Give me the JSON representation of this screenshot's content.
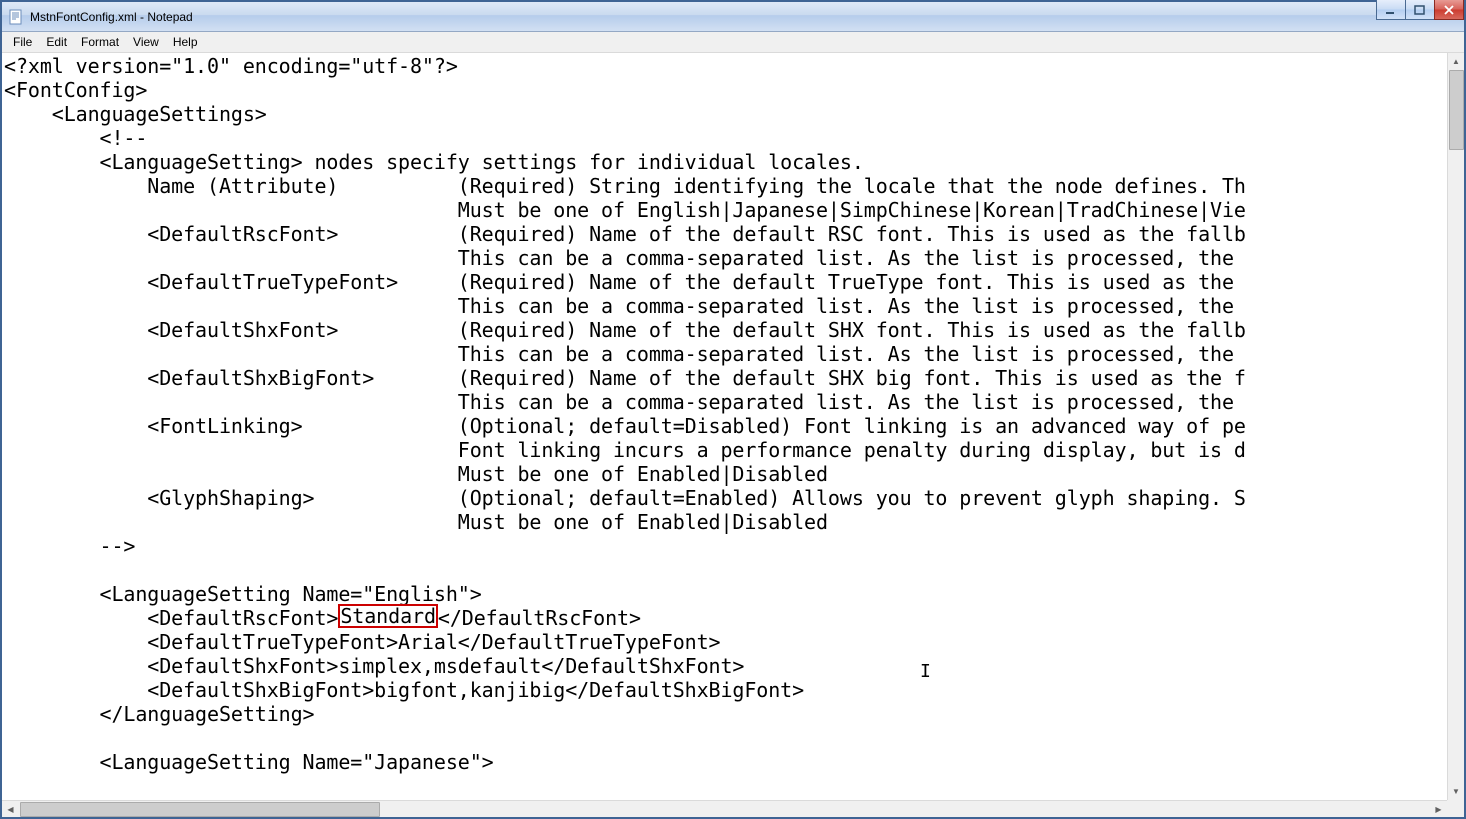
{
  "window": {
    "title": "MstnFontConfig.xml - Notepad"
  },
  "menu": {
    "file": "File",
    "edit": "Edit",
    "format": "Format",
    "view": "View",
    "help": "Help"
  },
  "content": {
    "l0": "<?xml version=\"1.0\" encoding=\"utf-8\"?>",
    "l1": "<FontConfig>",
    "l2": "    <LanguageSettings>",
    "l3": "        <!--",
    "l4": "        <LanguageSetting> nodes specify settings for individual locales.",
    "l5": "            Name (Attribute)          (Required) String identifying the locale that the node defines. Th",
    "l6": "                                      Must be one of English|Japanese|SimpChinese|Korean|TradChinese|Vie",
    "l7": "            <DefaultRscFont>          (Required) Name of the default RSC font. This is used as the fallb",
    "l8": "                                      This can be a comma-separated list. As the list is processed, the ",
    "l9": "            <DefaultTrueTypeFont>     (Required) Name of the default TrueType font. This is used as the ",
    "l10": "                                      This can be a comma-separated list. As the list is processed, the ",
    "l11": "            <DefaultShxFont>          (Required) Name of the default SHX font. This is used as the fallb",
    "l12": "                                      This can be a comma-separated list. As the list is processed, the ",
    "l13": "            <DefaultShxBigFont>       (Required) Name of the default SHX big font. This is used as the f",
    "l14": "                                      This can be a comma-separated list. As the list is processed, the ",
    "l15": "            <FontLinking>             (Optional; default=Disabled) Font linking is an advanced way of pe",
    "l16": "                                      Font linking incurs a performance penalty during display, but is d",
    "l17": "                                      Must be one of Enabled|Disabled",
    "l18": "            <GlyphShaping>            (Optional; default=Enabled) Allows you to prevent glyph shaping. S",
    "l19": "                                      Must be one of Enabled|Disabled",
    "l20": "        -->",
    "l21": "",
    "l22": "        <LanguageSetting Name=\"English\">",
    "l23a": "            <DefaultRscFont>",
    "l23hl": "Standard",
    "l23b": "</DefaultRscFont>",
    "l24": "            <DefaultTrueTypeFont>Arial</DefaultTrueTypeFont>",
    "l25": "            <DefaultShxFont>simplex,msdefault</DefaultShxFont>",
    "l26": "            <DefaultShxBigFont>bigfont,kanjibig</DefaultShxBigFont>",
    "l27": "        </LanguageSetting>",
    "l28": "",
    "l29": "        <LanguageSetting Name=\"Japanese\">"
  }
}
